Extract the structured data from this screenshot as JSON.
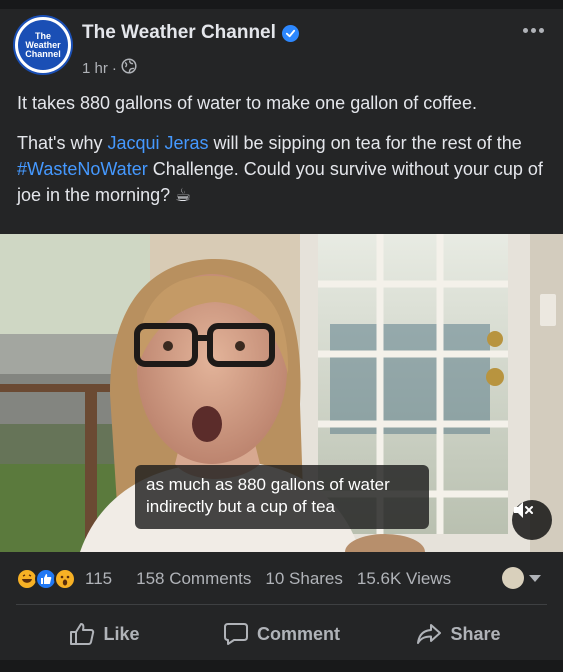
{
  "post": {
    "page_name": "The Weather Channel",
    "avatar_text": [
      "The",
      "Weather",
      "Channel"
    ],
    "time": "1 hr",
    "separator": "·",
    "paragraph1": "It takes 880 gallons of water to make one gallon of coffee.",
    "p2_before": "That's why ",
    "p2_mention": "Jacqui Jeras",
    "p2_middle": " will be sipping on tea for the rest of the ",
    "p2_hashtag": "#WasteNoWater",
    "p2_after": " Challenge. Could you survive without your cup of joe in the morning? ☕"
  },
  "video": {
    "caption_line1": "as much as 880 gallons of water",
    "caption_line2": "indirectly but a cup of tea"
  },
  "stats": {
    "reactions_count": "115",
    "comments": "158 Comments",
    "shares": "10 Shares",
    "views": "15.6K Views"
  },
  "actions": {
    "like": "Like",
    "comment": "Comment",
    "share": "Share"
  },
  "colors": {
    "background": "#18191a",
    "card": "#242526",
    "link": "#4599ff",
    "verified": "#2d88ff",
    "like_blue": "#2078f4"
  },
  "icons": [
    "verified-icon",
    "globe-icon",
    "more-icon",
    "mute-icon",
    "haha-icon",
    "like-reaction-icon",
    "wow-icon",
    "like-icon",
    "comment-icon",
    "share-icon"
  ]
}
